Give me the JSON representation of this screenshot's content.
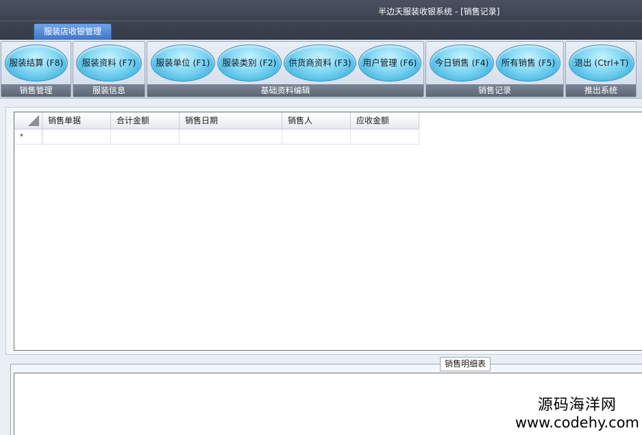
{
  "window": {
    "title": "半边天服装收银系统 - [销售记录]"
  },
  "tabs": [
    {
      "label": "服装店收银管理",
      "active": true
    }
  ],
  "ribbon": {
    "groups": [
      {
        "label": "销售管理",
        "buttons": [
          "服装结算 (F8)"
        ]
      },
      {
        "label": "服装信息",
        "buttons": [
          "服装资料 (F7)"
        ]
      },
      {
        "label": "基础资料编辑",
        "buttons": [
          "服装单位 (F1)",
          "服装类别 (F2)",
          "供货商资料 (F3)",
          "用户管理 (F6)"
        ]
      },
      {
        "label": "销售记录",
        "buttons": [
          "今日销售 (F4)",
          "所有销售 (F5)"
        ]
      },
      {
        "label": "推出系统",
        "buttons": [
          "退出 (Ctrl+T)"
        ]
      }
    ]
  },
  "sales_grid": {
    "columns": [
      "销售单据",
      "合计金额",
      "销售日期",
      "销售人",
      "应收金额"
    ],
    "new_row_marker": "*"
  },
  "detail": {
    "title": "销售明细表"
  },
  "watermark": {
    "line1": "源码海洋网",
    "line2": "www.codehy.com"
  },
  "colors": {
    "tab_active": "#3e74c8",
    "ribbon_button": "#7fd6f3",
    "group_label_bg": "#5d6675",
    "titlebar_bg": "#3c4250"
  }
}
